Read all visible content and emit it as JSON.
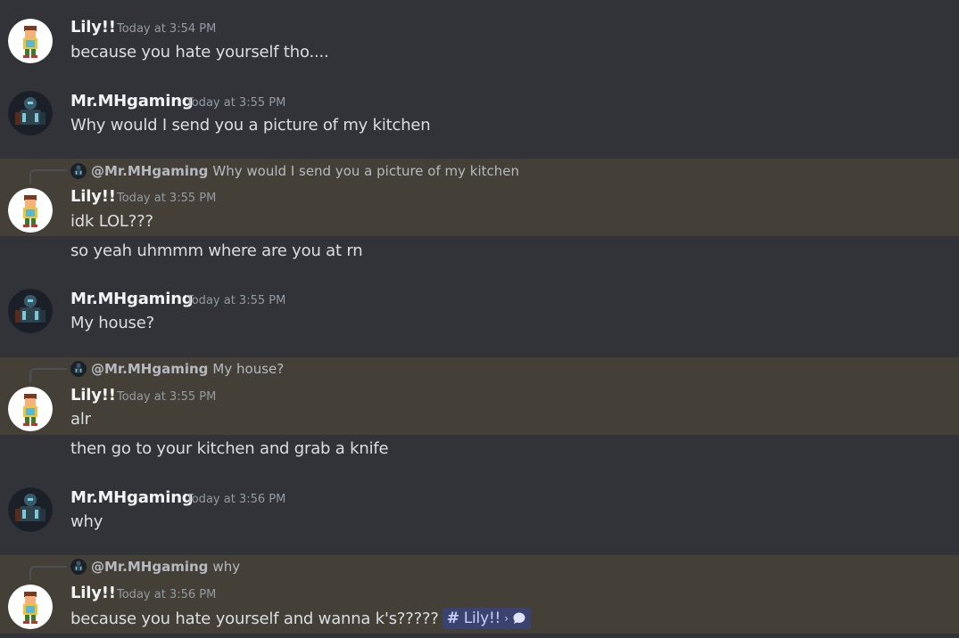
{
  "users": {
    "lily": {
      "name": "Lily!!",
      "avatar_icon": "lily-avatar-icon"
    },
    "mh": {
      "name": "Mr.MHgaming",
      "avatar_icon": "mhgaming-avatar-icon",
      "mention": "@Mr.MHgaming"
    }
  },
  "messages": [
    {
      "author": "Lily!!",
      "time": "Today at 3:54 PM",
      "lines": [
        "because you hate yourself tho...."
      ]
    },
    {
      "author": "Mr.MHgaming",
      "time": "Today at 3:55 PM",
      "lines": [
        "Why would I send you a picture of my kitchen"
      ]
    },
    {
      "reply_to": {
        "author": "@Mr.MHgaming",
        "text": "Why would I send you a picture of my kitchen"
      },
      "author": "Lily!!",
      "time": "Today at 3:55 PM",
      "lines": [
        "idk LOL???",
        "so yeah uhmmm where are you at rn"
      ]
    },
    {
      "author": "Mr.MHgaming",
      "time": "Today at 3:55 PM",
      "lines": [
        "My house?"
      ]
    },
    {
      "reply_to": {
        "author": "@Mr.MHgaming",
        "text": "My house?"
      },
      "author": "Lily!!",
      "time": "Today at 3:55 PM",
      "lines": [
        "alr",
        "then go to your kitchen and grab a knife"
      ]
    },
    {
      "author": "Mr.MHgaming",
      "time": "Today at 3:56 PM",
      "lines": [
        "why"
      ]
    },
    {
      "reply_to": {
        "author": "@Mr.MHgaming",
        "text": "why"
      },
      "author": "Lily!!",
      "time": "Today at 3:56 PM",
      "lines": [
        "because you hate yourself and wanna k's?????"
      ],
      "channel_mention": {
        "name": "Lily!!",
        "icon": "thread-bubble-icon"
      }
    }
  ],
  "colors": {
    "background": "#313338",
    "highlight": "#444037",
    "mention_bg": "#3c4270",
    "mention_text": "#c9cdfb"
  }
}
